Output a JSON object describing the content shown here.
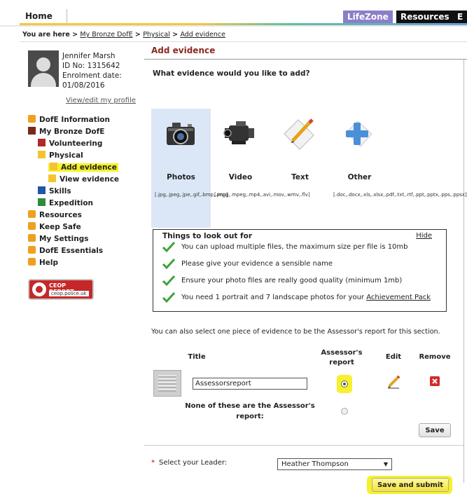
{
  "nav": {
    "home": "Home",
    "lifezone": "LifeZone",
    "resources": "Resources",
    "extra": "E"
  },
  "breadcrumb": {
    "prefix": "You are here >",
    "items": [
      "My Bronze DofE",
      "Physical",
      "Add evidence"
    ],
    "sep": ">"
  },
  "profile": {
    "name": "Jennifer Marsh",
    "id": "ID No: 1315642",
    "enrol_label": "Enrolment date:",
    "enrol_date": "01/08/2016",
    "edit_link": "View/edit my profile"
  },
  "menu": [
    {
      "label": "DofE Information",
      "icon": "info-icon",
      "color": "#f0a020"
    },
    {
      "label": "My Bronze DofE",
      "icon": "bronze-square",
      "color": "#7a2a14"
    },
    {
      "label": "Volunteering",
      "icon": "red-square",
      "color": "#b02828"
    },
    {
      "label": "Physical",
      "icon": "yellow-square",
      "color": "#f4c430"
    },
    {
      "label": "Add evidence",
      "icon": "yellow-square",
      "color": "#f4c430"
    },
    {
      "label": "View evidence",
      "icon": "yellow-square",
      "color": "#f4c430"
    },
    {
      "label": "Skills",
      "icon": "blue-square",
      "color": "#1f57a8"
    },
    {
      "label": "Expedition",
      "icon": "green-square",
      "color": "#2e8b3a"
    },
    {
      "label": "Resources",
      "icon": "folder-icon",
      "color": "#f0a020"
    },
    {
      "label": "Keep Safe",
      "icon": "keep-safe-icon",
      "color": "#f0a020"
    },
    {
      "label": "My Settings",
      "icon": "settings-icon",
      "color": "#f0a020"
    },
    {
      "label": "DofE Essentials",
      "icon": "essentials-icon",
      "color": "#f0a020"
    },
    {
      "label": "Help",
      "icon": "help-icon",
      "color": "#f0a020"
    }
  ],
  "ceop": {
    "title": "CEOP REPORT",
    "url": "ceop.police.uk"
  },
  "main": {
    "title": "Add evidence",
    "question": "What evidence would you like to add?",
    "types": [
      {
        "name": "Photos",
        "ext": "[.jpg,.jpeg,.jpe,.gif,.bmp,.png]",
        "icon": "camera-icon"
      },
      {
        "name": "Video",
        "ext": "[.mpg,.mpeg,.mp4,.avi,.mov,.wmv,.flv]",
        "icon": "video-camera-icon"
      },
      {
        "name": "Text",
        "ext": "",
        "icon": "pencil-paper-icon"
      },
      {
        "name": "Other",
        "ext": "[.doc,.docx,.xls,.xlsx,.pdf,.txt,.rtf,.ppt,.pptx,.pps,.ppsx]",
        "icon": "plus-document-icon"
      }
    ],
    "things": {
      "title": "Things to look out for",
      "hide": "Hide",
      "tips": [
        "You can upload multiple files, the maximum size per file is 10mb",
        "Please give your evidence a sensible name",
        "Ensure your photo files are really good quality (minimum 1mb)",
        "You need 1 portrait and 7 landscape photos for your"
      ],
      "tip_link": "Achievement Pack"
    },
    "also": "You can also select one piece of evidence to be the Assessor's report for this section.",
    "cols": {
      "title": "Title",
      "assessor": "Assessor's report",
      "edit": "Edit",
      "remove": "Remove"
    },
    "evidence_title": "Assessorsreport",
    "none_label": "None of these are the Assessor's report:",
    "save": "Save",
    "leader_label": "Select your Leader:",
    "leader_value": "Heather Thompson",
    "submit": "Save and submit"
  },
  "colors": {
    "accent": "#8b2a1f",
    "highlight": "#f6f12a",
    "check": "#3aa33a"
  }
}
